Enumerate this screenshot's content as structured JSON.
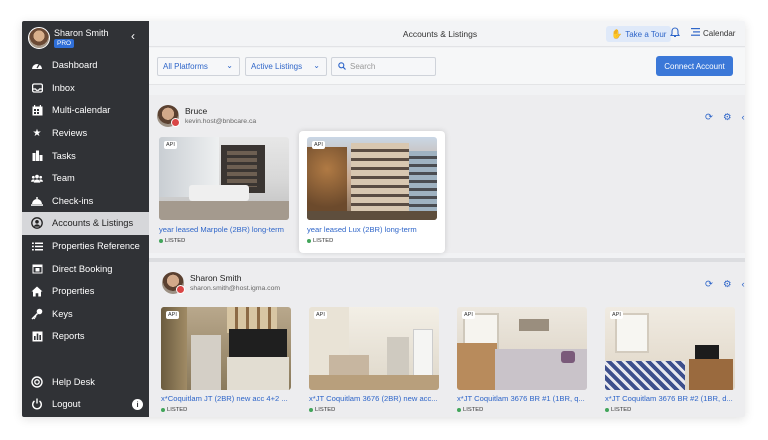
{
  "sidebar": {
    "user_name": "Sharon Smith",
    "plan_badge": "PRO",
    "items": [
      {
        "label": "Dashboard",
        "icon": "dashboard-icon"
      },
      {
        "label": "Inbox",
        "icon": "inbox-icon"
      },
      {
        "label": "Multi-calendar",
        "icon": "calendar-grid-icon"
      },
      {
        "label": "Reviews",
        "icon": "star-icon"
      },
      {
        "label": "Tasks",
        "icon": "tasks-icon"
      },
      {
        "label": "Team",
        "icon": "team-icon"
      },
      {
        "label": "Check-ins",
        "icon": "bell-desk-icon"
      },
      {
        "label": "Accounts & Listings",
        "icon": "account-icon",
        "active": true
      },
      {
        "label": "Properties Reference",
        "icon": "list-icon"
      },
      {
        "label": "Direct Booking",
        "icon": "booking-icon"
      },
      {
        "label": "Properties",
        "icon": "house-icon"
      },
      {
        "label": "Keys",
        "icon": "key-icon"
      },
      {
        "label": "Reports",
        "icon": "reports-icon"
      }
    ],
    "help_label": "Help Desk",
    "logout_label": "Logout"
  },
  "header": {
    "title": "Accounts & Listings",
    "tour_label": "Take a Tour",
    "calendar_label": "Calendar"
  },
  "filters": {
    "platform": "All Platforms",
    "listing_status": "Active Listings",
    "search_placeholder": "Search",
    "connect_label": "Connect Account"
  },
  "accounts": [
    {
      "name": "Bruce",
      "email": "kevin.host@bnbcare.ca",
      "listings": [
        {
          "api": "API",
          "title": "year leased Marpole (2BR) long-term",
          "status": "LISTED"
        },
        {
          "api": "API",
          "title": "year leased Lux (2BR) long-term",
          "status": "LISTED"
        }
      ]
    },
    {
      "name": "Sharon  Smith",
      "email": "sharon.smith@host.igma.com",
      "listings": [
        {
          "api": "API",
          "title": "x*Coquitlam JT (2BR) new acc 4+2 ...",
          "status": "LISTED"
        },
        {
          "api": "API",
          "title": "x*JT Coquitlam 3676 (2BR) new acc...",
          "status": "LISTED"
        },
        {
          "api": "API",
          "title": "x*JT Coquitlam 3676 BR #1 (1BR, q...",
          "status": "LISTED"
        },
        {
          "api": "API",
          "title": "x*JT Coquitlam 3676 BR #2 (1BR, d...",
          "status": "LISTED"
        }
      ]
    }
  ],
  "colors": {
    "sidebar_bg": "#303236",
    "accent_blue": "#2f66c9",
    "listed_green": "#42a55a",
    "badge_red": "#d94545"
  }
}
